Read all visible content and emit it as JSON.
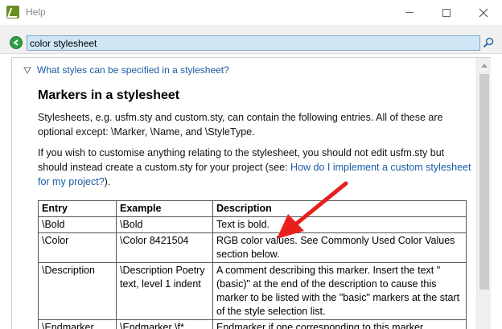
{
  "window": {
    "title": "Help",
    "minimize_label": "—",
    "maximize_label": "☐",
    "close_label": "✕"
  },
  "search": {
    "value": "color stylesheet"
  },
  "section": {
    "toggle_label": "What styles can be specified in a stylesheet?"
  },
  "article": {
    "heading": "Markers in a stylesheet",
    "para1": "Stylesheets, e.g. usfm.sty and custom.sty, can contain the following entries. All of these are optional except: \\Marker, \\Name, and \\StyleType.",
    "para2_pre": "If you wish to customise anything relating to the stylesheet, you should not edit usfm.sty but should instead create a custom.sty for your project (see: ",
    "para2_link": "How do I implement a custom stylesheet for my project?",
    "para2_post": ")."
  },
  "table": {
    "headers": [
      "Entry",
      "Example",
      "Description"
    ],
    "rows": [
      [
        "\\Bold",
        "\\Bold",
        "Text is bold."
      ],
      [
        "\\Color",
        "\\Color 8421504",
        "RGB color values. See Commonly Used Color Values section below."
      ],
      [
        "\\Description",
        "\\Description Poetry text, level 1 indent",
        "A comment describing this marker. Insert the text \"(basic)\" at the end of the description to cause this marker to be listed with the \"basic\" markers at the start of the style selection list."
      ],
      [
        "\\Endmarker",
        "\\Endmarker \\f*",
        "Endmarker if one corresponding to this marker"
      ]
    ]
  },
  "colors": {
    "link": "#1a5ba6",
    "arrow": "#e8201c",
    "search_bg": "#cfe6f5"
  }
}
